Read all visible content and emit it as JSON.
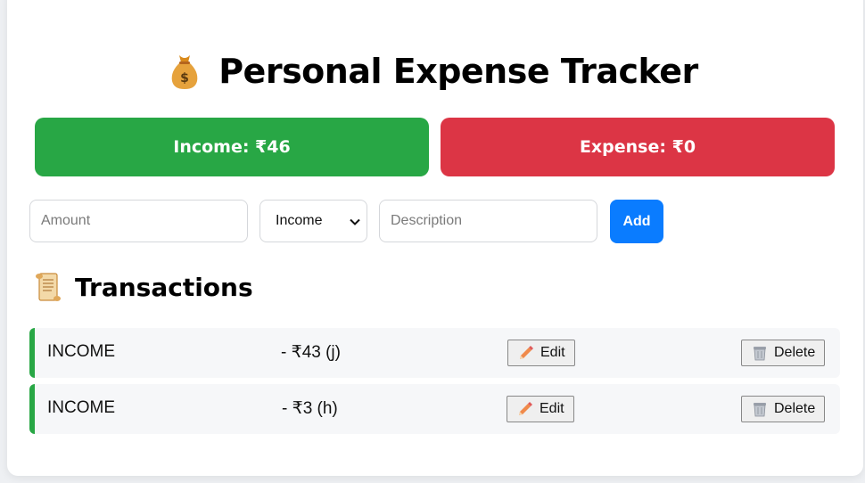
{
  "header": {
    "title": "Personal Expense Tracker",
    "icon": "money-bag-icon"
  },
  "summary": {
    "income_label": "Income: ₹46",
    "expense_label": "Expense: ₹0",
    "income_color": "#28a745",
    "expense_color": "#dc3545"
  },
  "form": {
    "amount_placeholder": "Amount",
    "type_selected": "Income",
    "description_placeholder": "Description",
    "add_label": "Add",
    "add_color": "#0a7cff"
  },
  "transactions": {
    "title": "Transactions",
    "icon": "scroll-icon",
    "items": [
      {
        "type": "INCOME",
        "amount": "- ₹43 (j)",
        "edit_label": "Edit",
        "delete_label": "Delete"
      },
      {
        "type": "INCOME",
        "amount": "- ₹3 (h)",
        "edit_label": "Edit",
        "delete_label": "Delete"
      }
    ]
  }
}
